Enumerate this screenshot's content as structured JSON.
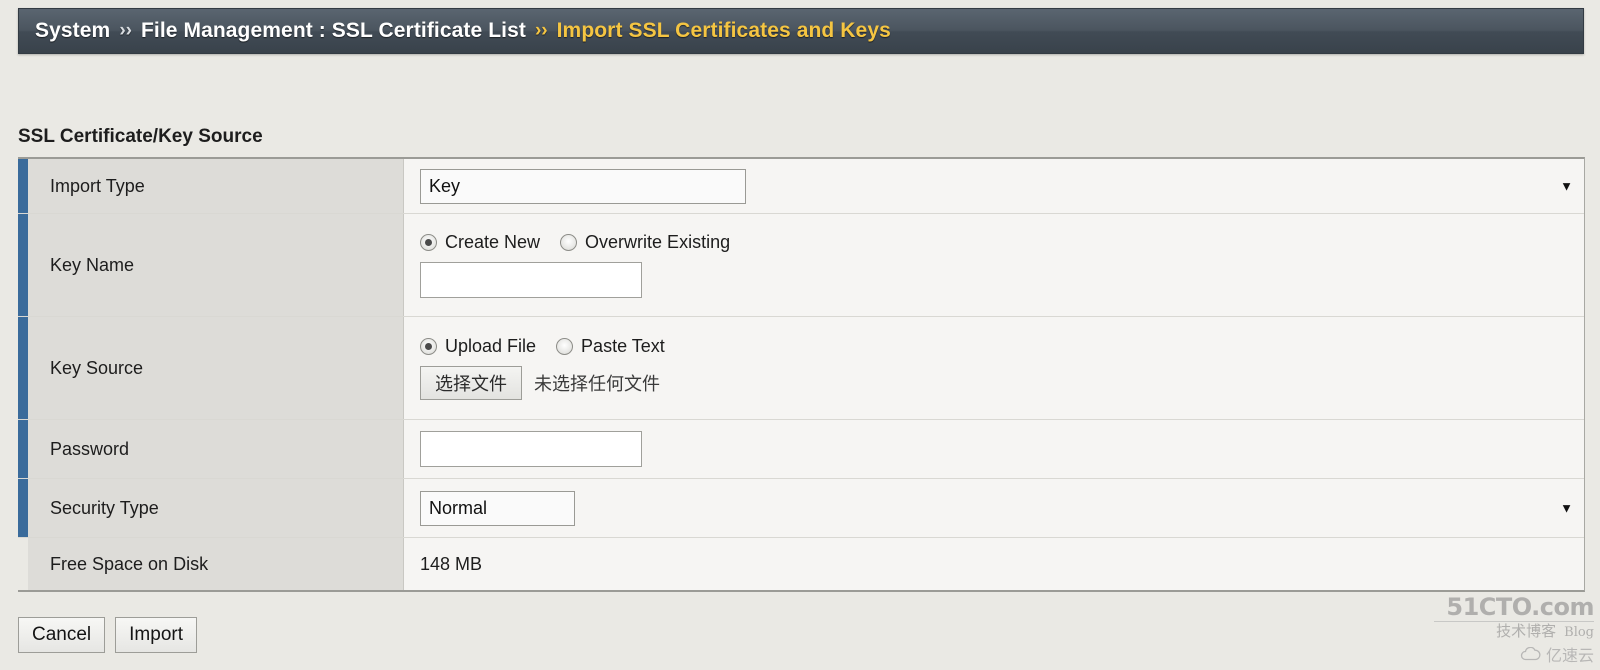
{
  "breadcrumb": {
    "items": [
      {
        "label": "System",
        "current": false
      },
      {
        "label": "File Management : SSL Certificate List",
        "current": false
      },
      {
        "label": "Import SSL Certificates and Keys",
        "current": true
      }
    ],
    "separator": "››"
  },
  "section": {
    "title": "SSL Certificate/Key Source"
  },
  "form": {
    "import_type": {
      "label": "Import Type",
      "value": "Key",
      "options": [
        "Key"
      ],
      "arrow": "▼"
    },
    "key_name": {
      "label": "Key Name",
      "mode_create": "Create New",
      "mode_overwrite": "Overwrite Existing",
      "selected_mode": "Create New",
      "input_value": "",
      "input_placeholder": ""
    },
    "key_source": {
      "label": "Key Source",
      "mode_upload": "Upload File",
      "mode_paste": "Paste Text",
      "selected_mode": "Upload File",
      "file_button": "选择文件",
      "file_status": "未选择任何文件"
    },
    "password": {
      "label": "Password",
      "value": "",
      "placeholder": ""
    },
    "security_type": {
      "label": "Security Type",
      "value": "Normal",
      "options": [
        "Normal"
      ],
      "arrow": "▼"
    },
    "free_space": {
      "label": "Free Space on Disk",
      "value": "148 MB"
    }
  },
  "actions": {
    "cancel": "Cancel",
    "import": "Import"
  },
  "watermark": {
    "main": "51CTO.com",
    "sub": "技术博客",
    "blog": "Blog",
    "cloud": "亿速云"
  },
  "colors": {
    "accent_blue": "#3a6b9b",
    "breadcrumb_current": "#f5c542",
    "header_bg": "#4b555f",
    "page_bg": "#eae9e4",
    "label_bg": "#dddcd8",
    "value_bg": "#f6f5f3",
    "focus_ring": "#7ba3d0"
  }
}
